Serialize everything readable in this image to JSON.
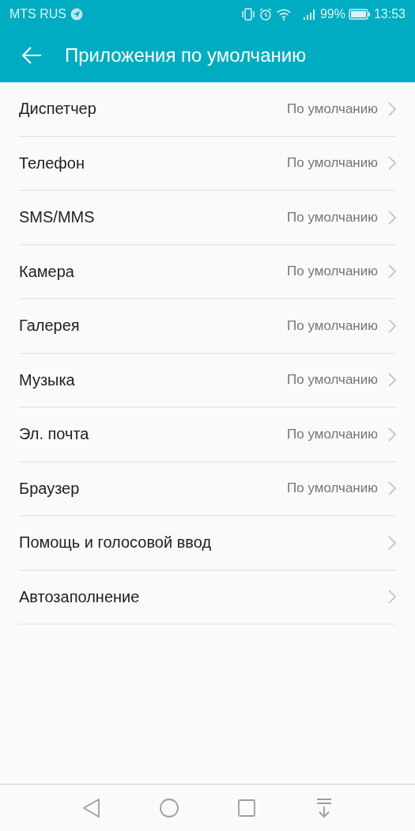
{
  "status_bar": {
    "carrier": "MTS RUS",
    "battery": "99%",
    "time": "13:53"
  },
  "app_bar": {
    "title": "Приложения по умолчанию"
  },
  "items": [
    {
      "label": "Диспетчер",
      "value": "По умолчанию"
    },
    {
      "label": "Телефон",
      "value": "По умолчанию"
    },
    {
      "label": "SMS/MMS",
      "value": "По умолчанию"
    },
    {
      "label": "Камера",
      "value": "По умолчанию"
    },
    {
      "label": "Галерея",
      "value": "По умолчанию"
    },
    {
      "label": "Музыка",
      "value": "По умолчанию"
    },
    {
      "label": "Эл. почта",
      "value": "По умолчанию"
    },
    {
      "label": "Браузер",
      "value": "По умолчанию"
    },
    {
      "label": "Помощь и голосовой ввод"
    },
    {
      "label": "Автозаполнение"
    }
  ]
}
